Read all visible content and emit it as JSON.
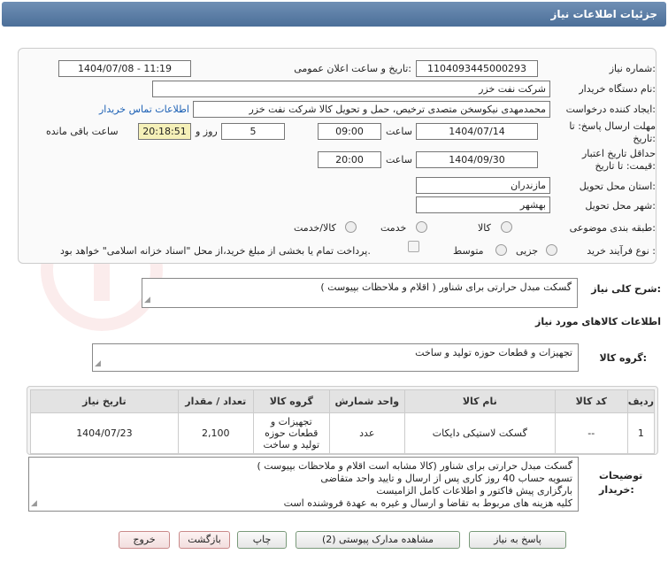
{
  "header": {
    "title": "جزئیات اطلاعات نیاز"
  },
  "form": {
    "need_number_label": "شماره نیاز:",
    "need_number": "1104093445000293",
    "announce_label": "تاریخ و ساعت اعلان عمومی:",
    "announce_value": "1404/07/08 - 11:19",
    "buyer_org_label": "نام دستگاه خریدار:",
    "buyer_org": "شرکت نفت خزر",
    "requester_label": "ایجاد کننده درخواست:",
    "requester": "محمدمهدی نیکوسخن متصدی ترخیص، حمل و تحویل کالا شرکت نفت خزر",
    "contact_link": "اطلاعات تماس خریدار",
    "deadline_label": "مهلت ارسال پاسخ: تا تاریخ:",
    "deadline_date": "1404/07/14",
    "time_label": "ساعت",
    "deadline_time": "09:00",
    "days_value": "5",
    "days_label": "روز و",
    "remaining_time": "20:18:51",
    "remaining_label": "ساعت باقی مانده",
    "validity_label": "حداقل تاریخ اعتبار قیمت: تا تاریخ:",
    "validity_date": "1404/09/30",
    "validity_time": "20:00",
    "province_label": "استان محل تحویل:",
    "province": "مازندران",
    "city_label": "شهر محل تحویل:",
    "city": "بهشهر",
    "category_label": "طبقه بندی موضوعی:",
    "category_options": [
      "کالا",
      "خدمت",
      "کالا/خدمت"
    ],
    "process_label": "نوع فرآیند خرید :",
    "process_options": [
      "جزیی",
      "متوسط"
    ],
    "payment_note": "پرداخت تمام یا بخشی از مبلغ خرید،از محل \"اسناد خزانه اسلامی\" خواهد بود."
  },
  "summary": {
    "label": "شرح کلی نیاز:",
    "text": "گسکت مبدل حرارتی برای شناور  ( اقلام و ملاحظات بپیوست )"
  },
  "goods_info": {
    "title": "اطلاعات کالاهای مورد نیاز",
    "group_label": "گروه کالا:",
    "group_value": "تجهیزات و قطعات حوزه تولید و ساخت"
  },
  "table": {
    "headers": [
      "ردیف",
      "کد کالا",
      "نام کالا",
      "واحد شمارش",
      "گروه کالا",
      "تعداد / مقدار",
      "تاریخ نیاز"
    ],
    "rows": [
      {
        "row": "1",
        "code": "--",
        "name": "گسکت لاستیکی دایکات",
        "unit": "عدد",
        "group": "تجهیزات و قطعات حوزه تولید و ساخت",
        "qty": "2,100",
        "date": "1404/07/23"
      }
    ]
  },
  "notes": {
    "label": "توضیحات خریدار:",
    "lines": [
      "گسکت مبدل حرارتی برای شناور (کالا مشابه است اقلام و ملاحظات بپیوست )",
      "تسویه حساب 40 روز کاری پس از ارسال و تایید واحد متقاضی",
      "بارگزاری پیش فاکتور و اطلاعات کامل الزامیست",
      "کلیه هزینه های مربوط به تقاضا و ارسال و غیره به عهدة فروشنده است"
    ]
  },
  "buttons": {
    "reply": "پاسخ به نیاز",
    "docs": "مشاهده مدارک پیوستی (2)",
    "print": "چاپ",
    "back": "بازگشت",
    "exit": "خروج"
  },
  "colors": {
    "header": "#5a7ca6",
    "link": "#1a5fb4",
    "yellow": "#f5f0b8"
  }
}
